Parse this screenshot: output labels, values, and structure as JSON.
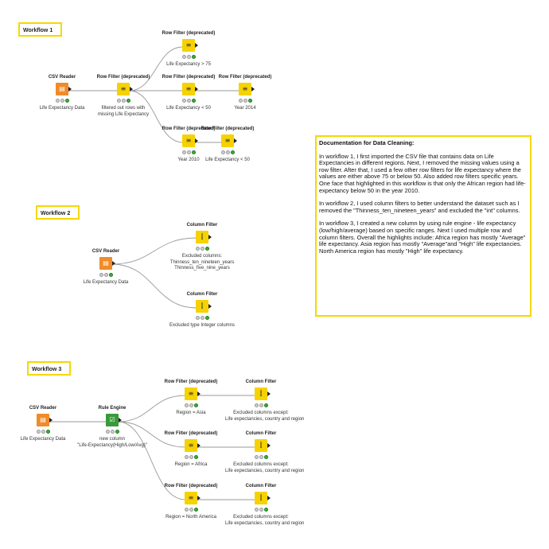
{
  "workflow_labels": [
    "Workflow 1",
    "Workflow 2",
    "Workflow 3"
  ],
  "nodes": {
    "w1_csv": {
      "title": "CSV Reader",
      "caption": [
        "Life Expectancy Data"
      ],
      "icon": "table-reader-icon"
    },
    "w1_rf_missing": {
      "title": "Row Filter (deprecated)",
      "caption": [
        "filtered out rows with",
        "missing Life Expectancy"
      ],
      "icon": "row-filter-icon"
    },
    "w1_rf_gt75": {
      "title": "Row Filter (deprecated)",
      "caption": [
        "Life Expectancy > 75"
      ],
      "icon": "row-filter-icon"
    },
    "w1_rf_lt50": {
      "title": "Row Filter (deprecated)",
      "caption": [
        "Life Expectancy < 50"
      ],
      "icon": "row-filter-icon"
    },
    "w1_rf_2014": {
      "title": "Row Filter (deprecated)",
      "caption": [
        "Year 2014"
      ],
      "icon": "row-filter-icon"
    },
    "w1_rf_2010": {
      "title": "Row Filter (deprecated)",
      "caption": [
        "Year 2010"
      ],
      "icon": "row-filter-icon"
    },
    "w1_rf_lt50b": {
      "title": "Row Filter (deprecated)",
      "caption": [
        "Life Expectancy < 50"
      ],
      "icon": "row-filter-icon"
    },
    "w2_csv": {
      "title": "CSV Reader",
      "caption": [
        "Life Expectancy Data"
      ],
      "icon": "table-reader-icon"
    },
    "w2_cf1": {
      "title": "Column Filter",
      "caption": [
        "Excluded columns:",
        "Thinness_ten_nineteen_years",
        "Thinness_five_nine_years"
      ],
      "icon": "column-filter-icon"
    },
    "w2_cf2": {
      "title": "Column Filter",
      "caption": [
        "Excluded type Integer columns"
      ],
      "icon": "column-filter-icon"
    },
    "w3_csv": {
      "title": "CSV Reader",
      "caption": [
        "Life Expectancy Data"
      ],
      "icon": "table-reader-icon"
    },
    "w3_rule": {
      "title": "Rule Engine",
      "caption": [
        "new column",
        "\"Life-Expectancy(High/Low/Avg)\""
      ],
      "icon": "rule-engine-icon"
    },
    "w3_rf_asia": {
      "title": "Row Filter (deprecated)",
      "caption": [
        "Region = Asia"
      ],
      "icon": "row-filter-icon"
    },
    "w3_rf_africa": {
      "title": "Row Filter (deprecated)",
      "caption": [
        "Region = Africa"
      ],
      "icon": "row-filter-icon"
    },
    "w3_rf_na": {
      "title": "Row Filter (deprecated)",
      "caption": [
        "Region = North America"
      ],
      "icon": "row-filter-icon"
    },
    "w3_cf_asia": {
      "title": "Column Filter",
      "caption": [
        "Excluded columns except:",
        "Life expectancies, country and region"
      ],
      "icon": "column-filter-icon"
    },
    "w3_cf_africa": {
      "title": "Column Filter",
      "caption": [
        "Excluded columns except:",
        "Life expectancies, country and region"
      ],
      "icon": "column-filter-icon"
    },
    "w3_cf_na": {
      "title": "Column Filter",
      "caption": [
        "Excluded columns except:",
        "Life expectancies, country and region"
      ],
      "icon": "column-filter-icon"
    }
  },
  "documentation": {
    "title": "Documentation for Data Cleaning:",
    "paragraphs": [
      "In workflow 1, I first imported the CSV file that contains data on Life Expectancies in different regions. Next, I removed the missing values using a row filter. After that, I used a few other row filters for life expectancy where the values are either above 75 or below 50. Also added row filters specific years. One face that highlighted in this workflow is that only the African region had life-expectancy below 50 in the year 2010.",
      "In workflow 2, I used column filters to better understand the dataset such as I removed the \"Thinness_ten_nineteen_years\" and excluded the \"int\" columns.",
      "In workflow 3, I created a new column by using rule engine - life expectancy (low/high/average) based on specific ranges. Next I used multiple row and column filters. Overall the highlights include: Africa region has mostly \"Average\" life expectancy. Asia region has mostly \"Average\"and \"High\" life expectancies. North America region has mostly \"High\" life expectancy."
    ]
  },
  "colors": {
    "frame": "#f5d800",
    "reader": "#f08b2a",
    "filter": "#f6d200",
    "rule": "#3a9a3a",
    "status_ok": "#35b335"
  }
}
